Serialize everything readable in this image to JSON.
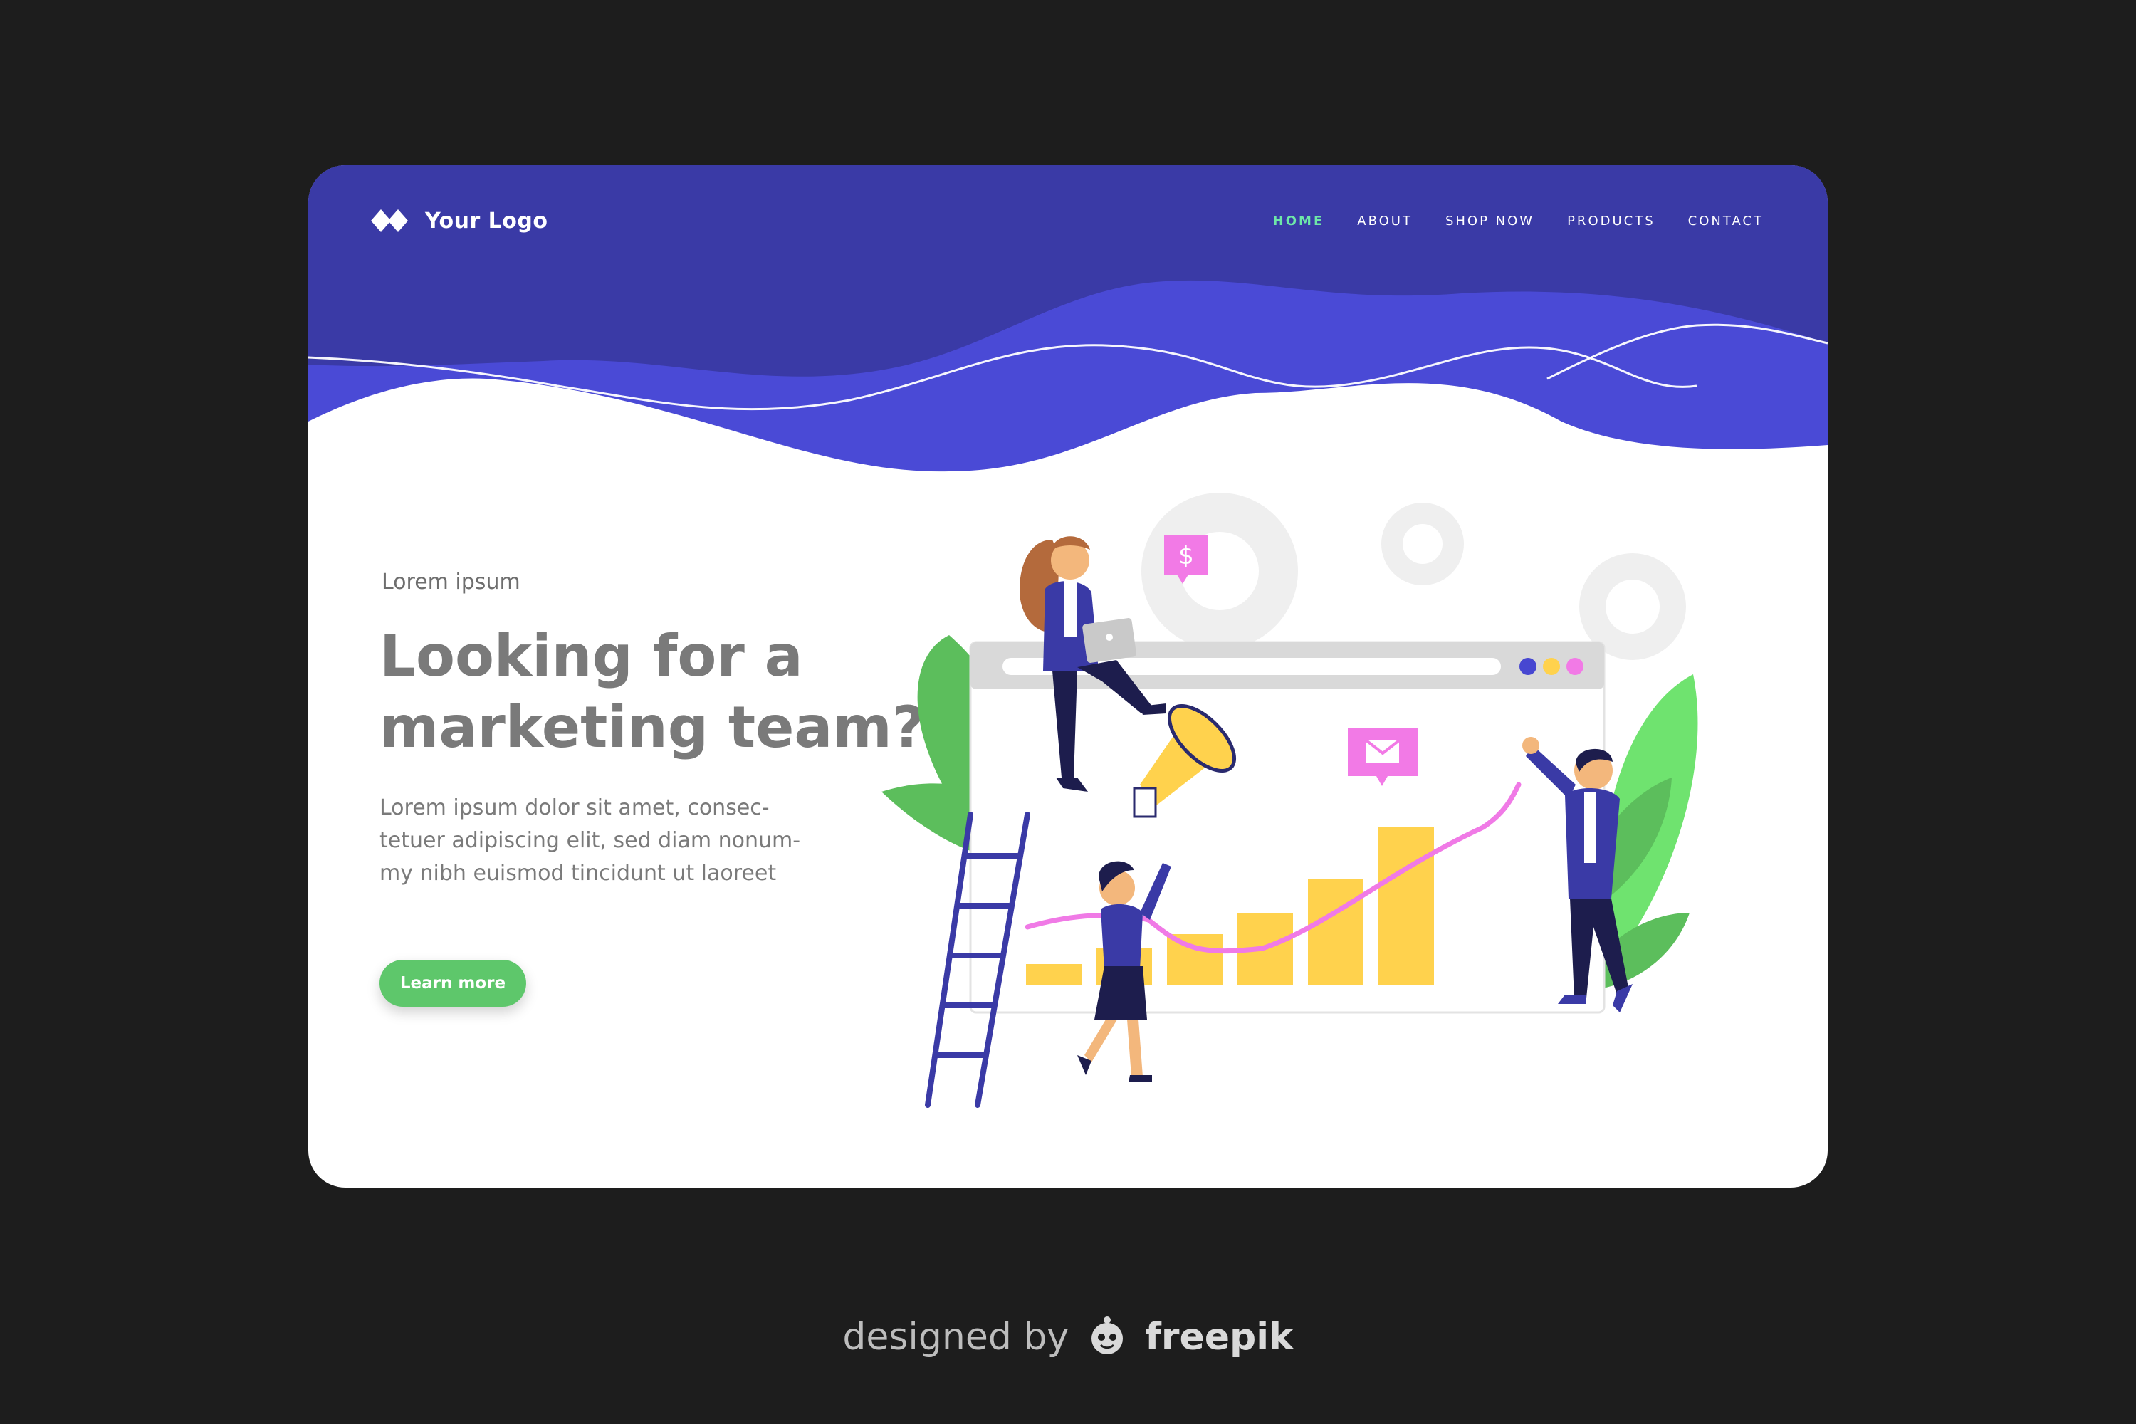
{
  "logo": {
    "text": "Your Logo",
    "icon": "diamond-logo-icon"
  },
  "nav": {
    "items": [
      {
        "label": "HOME",
        "active": true
      },
      {
        "label": "ABOUT",
        "active": false
      },
      {
        "label": "SHOP NOW",
        "active": false
      },
      {
        "label": "PRODUCTS",
        "active": false
      },
      {
        "label": "CONTACT",
        "active": false
      }
    ]
  },
  "hero": {
    "eyebrow": "Lorem ipsum",
    "headline_line1": "Looking for a",
    "headline_line2": "marketing team?",
    "body_line1": "Lorem ipsum dolor sit amet, consec-",
    "body_line2": "tetuer adipiscing elit, sed diam nonum-",
    "body_line3": "my nibh euismod tincidunt ut laoreet",
    "cta_label": "Learn more"
  },
  "illustration": {
    "dollar_badge": "$",
    "icons": [
      "gear-icon",
      "megaphone-icon",
      "envelope-icon",
      "laptop-icon",
      "ladder-icon",
      "bar-chart-icon",
      "leaf-icon"
    ]
  },
  "credit": {
    "prefix": "designed by",
    "brand": "freepik"
  },
  "colors": {
    "background": "#1d1d1d",
    "header": "#3a3aa6",
    "wave": "#4848d4",
    "nav_active": "#6ee7a8",
    "cta": "#5ec76b",
    "chart_bar": "#ffd24d",
    "trend_line": "#f07ae6",
    "pink_badge": "#f27ae6"
  }
}
